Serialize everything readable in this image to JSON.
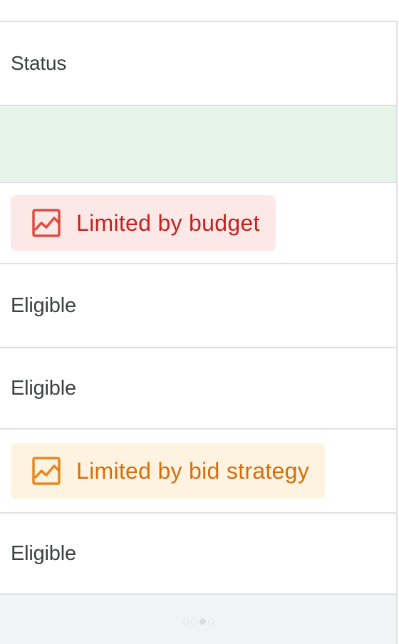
{
  "table": {
    "header": {
      "status_label": "Status"
    },
    "rows": [
      {
        "status": "Limited by budget",
        "style": "warning-red",
        "icon": "chart-line-icon"
      },
      {
        "status": "Eligible"
      },
      {
        "status": "Eligible"
      },
      {
        "status": "Limited by bid strategy",
        "style": "warning-orange",
        "icon": "chart-line-icon"
      },
      {
        "status": "Eligible"
      }
    ],
    "summary_row": {
      "color": "#e6f4ea"
    }
  },
  "colors": {
    "budget_chip_bg": "#fce8e6",
    "budget_chip_text": "#c5221f",
    "bid_chip_bg": "#fef3e0",
    "bid_chip_text": "#d56e0c",
    "border": "#dfe1e5"
  },
  "pager": {
    "dot_count": 4,
    "active_index": 2
  }
}
